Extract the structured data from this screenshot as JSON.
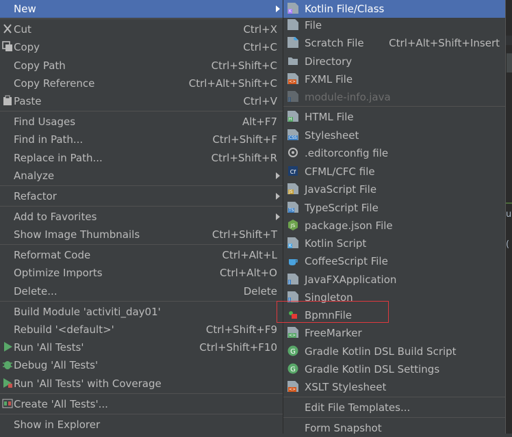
{
  "context_menu": {
    "items": [
      {
        "label": "New",
        "shortcut": "",
        "submenu": true,
        "selected": true
      },
      {
        "label": "Cut",
        "shortcut": "Ctrl+X",
        "icon": "cut-icon"
      },
      {
        "label": "Copy",
        "shortcut": "Ctrl+C",
        "icon": "copy-icon"
      },
      {
        "label": "Copy Path",
        "shortcut": "Ctrl+Shift+C"
      },
      {
        "label": "Copy Reference",
        "shortcut": "Ctrl+Alt+Shift+C"
      },
      {
        "label": "Paste",
        "shortcut": "Ctrl+V",
        "icon": "paste-icon"
      },
      {
        "label": "Find Usages",
        "shortcut": "Alt+F7"
      },
      {
        "label": "Find in Path...",
        "shortcut": "Ctrl+Shift+F"
      },
      {
        "label": "Replace in Path...",
        "shortcut": "Ctrl+Shift+R"
      },
      {
        "label": "Analyze",
        "shortcut": "",
        "submenu": true
      },
      {
        "label": "Refactor",
        "shortcut": "",
        "submenu": true
      },
      {
        "label": "Add to Favorites",
        "shortcut": "",
        "submenu": true
      },
      {
        "label": "Show Image Thumbnails",
        "shortcut": "Ctrl+Shift+T"
      },
      {
        "label": "Reformat Code",
        "shortcut": "Ctrl+Alt+L"
      },
      {
        "label": "Optimize Imports",
        "shortcut": "Ctrl+Alt+O"
      },
      {
        "label": "Delete...",
        "shortcut": "Delete"
      },
      {
        "label": "Build Module 'activiti_day01'",
        "shortcut": ""
      },
      {
        "label": "Rebuild '<default>'",
        "shortcut": "Ctrl+Shift+F9"
      },
      {
        "label": "Run 'All Tests'",
        "shortcut": "Ctrl+Shift+F10",
        "icon": "run-icon"
      },
      {
        "label": "Debug 'All Tests'",
        "shortcut": "",
        "icon": "debug-icon"
      },
      {
        "label": "Run 'All Tests' with Coverage",
        "shortcut": "",
        "icon": "coverage-icon"
      },
      {
        "label": "Create 'All Tests'...",
        "shortcut": "",
        "icon": "create-test-icon"
      },
      {
        "label": "Show in Explorer",
        "shortcut": ""
      }
    ]
  },
  "new_submenu": {
    "items": [
      {
        "label": "Kotlin File/Class",
        "shortcut": "",
        "selected": true,
        "icon": "kotlin-file-icon"
      },
      {
        "label": "File",
        "shortcut": "",
        "icon": "file-icon"
      },
      {
        "label": "Scratch File",
        "shortcut": "Ctrl+Alt+Shift+Insert",
        "icon": "scratch-file-icon"
      },
      {
        "label": "Directory",
        "shortcut": "",
        "icon": "folder-icon"
      },
      {
        "label": "FXML File",
        "shortcut": "",
        "icon": "fxml-icon"
      },
      {
        "label": "module-info.java",
        "shortcut": "",
        "disabled": true,
        "icon": "java-file-icon"
      },
      {
        "label": "HTML File",
        "shortcut": "",
        "icon": "html-file-icon"
      },
      {
        "label": "Stylesheet",
        "shortcut": "",
        "icon": "css-file-icon"
      },
      {
        "label": ".editorconfig file",
        "shortcut": "",
        "icon": "editorconfig-icon"
      },
      {
        "label": "CFML/CFC file",
        "shortcut": "",
        "icon": "cfml-icon"
      },
      {
        "label": "JavaScript File",
        "shortcut": "",
        "icon": "js-file-icon"
      },
      {
        "label": "TypeScript File",
        "shortcut": "",
        "icon": "ts-file-icon"
      },
      {
        "label": "package.json File",
        "shortcut": "",
        "icon": "nodejs-icon"
      },
      {
        "label": "Kotlin Script",
        "shortcut": "",
        "icon": "kotlin-script-icon"
      },
      {
        "label": "CoffeeScript File",
        "shortcut": "",
        "icon": "coffeescript-icon"
      },
      {
        "label": "JavaFXApplication",
        "shortcut": "",
        "icon": "java-file-icon"
      },
      {
        "label": "Singleton",
        "shortcut": "",
        "icon": "java-file-icon"
      },
      {
        "label": "BpmnFile",
        "shortcut": "",
        "icon": "bpmn-icon"
      },
      {
        "label": "FreeMarker",
        "shortcut": "",
        "icon": "freemarker-icon"
      },
      {
        "label": "Gradle Kotlin DSL Build Script",
        "shortcut": "",
        "icon": "gradle-icon"
      },
      {
        "label": "Gradle Kotlin DSL Settings",
        "shortcut": "",
        "icon": "gradle-icon"
      },
      {
        "label": "XSLT Stylesheet",
        "shortcut": "",
        "icon": "xslt-icon"
      },
      {
        "label": "Edit File Templates...",
        "shortcut": ""
      },
      {
        "label": "Form Snapshot",
        "shortcut": ""
      }
    ]
  },
  "editor_peek": {
    "text_1": "u",
    "text_2": "("
  },
  "colors": {
    "selection": "#4b6eaf",
    "highlight_box": "#e0393e",
    "menu_bg": "#3c3f41"
  }
}
